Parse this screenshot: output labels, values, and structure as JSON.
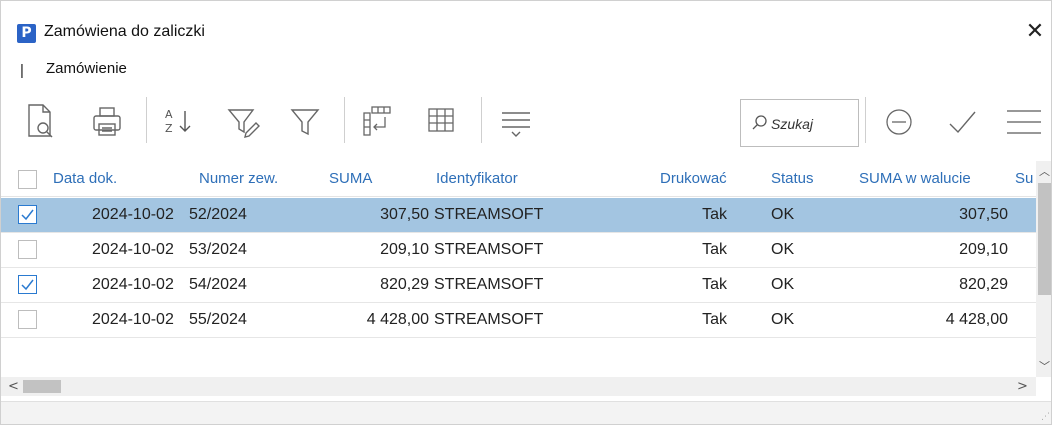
{
  "window": {
    "app_icon_letter": "P",
    "title": "Zamówiena do zaliczki",
    "close_glyph": "✕"
  },
  "menu": {
    "separator": "|",
    "items": [
      {
        "label": "Zamówienie"
      }
    ]
  },
  "toolbar": {
    "icons": [
      "document-preview-icon",
      "print-icon",
      "sort-az-icon",
      "filter-edit-icon",
      "filter-icon",
      "column-layout-icon",
      "grid-icon",
      "group-lines-icon",
      "minus-circle-icon",
      "check-icon",
      "menu-lines-icon"
    ],
    "search": {
      "placeholder": "Szukaj",
      "value": ""
    }
  },
  "grid": {
    "columns": [
      "Data dok.",
      "Numer zew.",
      "SUMA",
      "Identyfikator",
      "Drukować",
      "Status",
      "SUMA w walucie",
      "Su"
    ],
    "rows": [
      {
        "checked": true,
        "selected": true,
        "data": "2024-10-02",
        "numer": "52/2024",
        "suma": "307,50",
        "identyfikator": "STREAMSOFT",
        "drukowac": "Tak",
        "status": "OK",
        "suma_waluta": "307,50"
      },
      {
        "checked": false,
        "selected": false,
        "data": "2024-10-02",
        "numer": "53/2024",
        "suma": "209,10",
        "identyfikator": "STREAMSOFT",
        "drukowac": "Tak",
        "status": "OK",
        "suma_waluta": "209,10"
      },
      {
        "checked": true,
        "selected": false,
        "data": "2024-10-02",
        "numer": "54/2024",
        "suma": "820,29",
        "identyfikator": "STREAMSOFT",
        "drukowac": "Tak",
        "status": "OK",
        "suma_waluta": "820,29"
      },
      {
        "checked": false,
        "selected": false,
        "data": "2024-10-02",
        "numer": "55/2024",
        "suma": "4 428,00",
        "identyfikator": "STREAMSOFT",
        "drukowac": "Tak",
        "status": "OK",
        "suma_waluta": "4 428,00"
      }
    ]
  },
  "colors": {
    "header_text": "#2e6fb8",
    "selected_row": "#a3c5e1",
    "checkbox_check": "#2a7ad0",
    "app_icon": "#2b63c6"
  }
}
